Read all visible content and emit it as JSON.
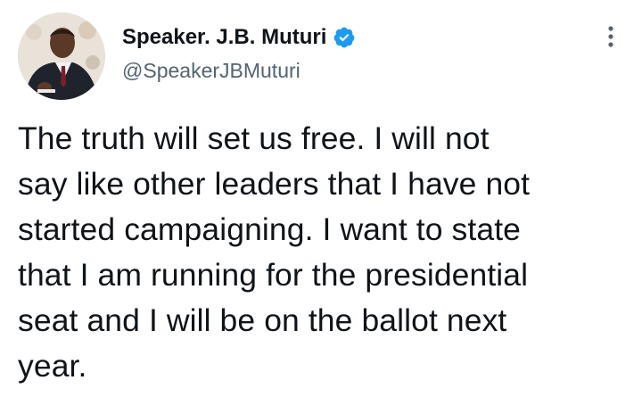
{
  "author": {
    "display_name": "Speaker. J.B. Muturi",
    "handle": "@SpeakerJBMuturi",
    "verified": true,
    "avatar_icon": "profile-photo"
  },
  "tweet": {
    "text": "The truth will set us free. I will not\nsay like other leaders that I have not\nstarted campaigning. I want to state\nthat I am running for the presidential\nseat and I will be on the ballot next\nyear."
  },
  "icons": {
    "verified": "verified-badge-icon",
    "more": "more-options-icon"
  },
  "colors": {
    "text": "#0f1419",
    "secondary": "#536471",
    "verified_blue": "#1d9bf0",
    "background": "#ffffff"
  }
}
